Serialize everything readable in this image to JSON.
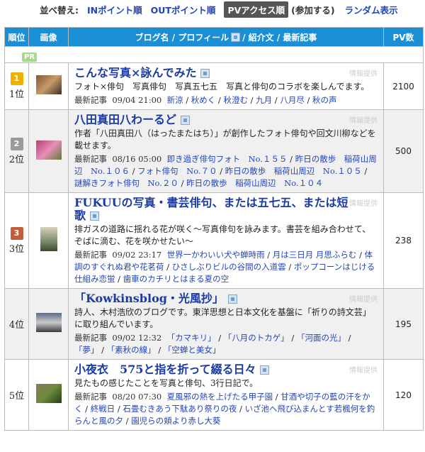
{
  "sortbar": {
    "label": "並べ替え:",
    "in": "INポイント順",
    "out": "OUTポイント順",
    "pv": "PVアクセス順",
    "join": "(参加する)",
    "random": "ランダム表示"
  },
  "table_header": {
    "rank": "順位",
    "image": "画像",
    "blog_name": "ブログ名 / プロフィール",
    "blog_rest": "/ 紹介文 / 最新記事",
    "pv": "PV数"
  },
  "pr": "PR",
  "latest_label": "最新記事",
  "info_label": "情報提供",
  "rows": [
    {
      "rank": "1位",
      "medal": "1",
      "title": "こんな写真×詠んでみた",
      "desc": "フォト×俳句　写真俳句　写真五七五　写真と俳句のコラボを楽しんでます。",
      "date": "09/04 21:00",
      "links": [
        "新涼",
        "秋めく",
        "秋澄む",
        "九月",
        "八月尽",
        "秋の声"
      ],
      "pv": "2100"
    },
    {
      "rank": "2位",
      "medal": "2",
      "title": "八田真田八わーるど",
      "desc": "作者「八田真田八（はったまたはち）」が創作したフォト俳句や回文川柳などを載せます。",
      "date": "08/16 05:00",
      "links": [
        "即き過ぎ俳句フォト　No.１５５",
        "昨日の散歩　稲荷山周辺　No.１０６",
        "フォト俳句　No.７０",
        "昨日の散歩　稲荷山周辺　No.１０５",
        "謎解きフォト俳句　No.２０",
        "昨日の散歩　稲荷山周辺　No.１０４"
      ],
      "pv": "500"
    },
    {
      "rank": "3位",
      "medal": "3",
      "title": "FUKUUの写真・書芸俳句、または五七五、または短歌",
      "desc": "排ガスの道路に揺れる花が咲く～写真俳句を詠みます。書芸を組み合わせて、ぞばに滴む、花を咲かせたい～",
      "date": "09/02 23:17",
      "links": [
        "世界一かわいい犬や蝉時雨",
        "月は三日月 月思ふらむ",
        "体調のすぐれぬ君や花茗荷",
        "ひさしぶりビルの谷間の入道雲",
        "ポップコーンはじける仕組み恋蛍",
        "歯車のカチリとはまる夏の空"
      ],
      "pv": "238"
    },
    {
      "rank": "4位",
      "medal": "",
      "title": "「Kowkinsblog・光風抄」",
      "desc": "詩人、木村浩欣のブログです。東洋思想と日本文化を基盤に「祈りの詩文芸」に取り組んでいます。",
      "date": "09/02 12:32",
      "links": [
        "「カマキリ」",
        "「八月のトカゲ」",
        "「河面の光」",
        "「夢」",
        "「素秋の線」",
        "「空蝉と美女」"
      ],
      "pv": "195"
    },
    {
      "rank": "5位",
      "medal": "",
      "title": "小夜衣　575と指を折って綴る日々",
      "desc": "見たもの感じたことを写真と俳句、3行日記で。",
      "date": "08/20 07:30",
      "links": [
        "夏風邪の熱を上げたる甲子園",
        "甘酒や切子の藍の汗をかく",
        "終戦日",
        "石畳むきあう下駄あり祭りの夜",
        "いざ池へ飛び込まんとす若楓何を釣らんと風の夕",
        "園児らの頬より赤し大葵"
      ],
      "pv": "120"
    }
  ]
}
